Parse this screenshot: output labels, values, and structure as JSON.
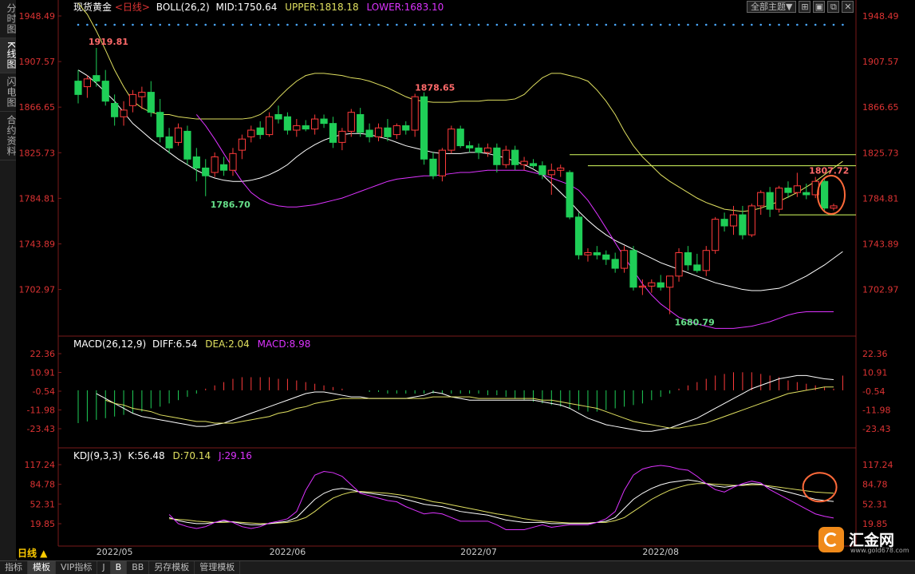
{
  "sidebar": {
    "tabs": [
      "分时图",
      "K线图",
      "闪电图",
      "合约资料"
    ],
    "active": 1
  },
  "header": {
    "symbol": "现货黄金",
    "period": "<日线>",
    "boll_label": "BOLL(26,2)",
    "mid": "MID:1750.64",
    "upper": "UPPER:1818.18",
    "lower": "LOWER:1683.10"
  },
  "top_buttons": {
    "theme": "全部主题▼"
  },
  "macd_header": {
    "name": "MACD(26,12,9)",
    "diff": "DIFF:6.54",
    "dea": "DEA:2.04",
    "macd": "MACD:8.98"
  },
  "kdj_header": {
    "name": "KDJ(9,3,3)",
    "k": "K:56.48",
    "d": "D:70.14",
    "j": "J:29.16"
  },
  "bottom_tabs": [
    "指标",
    "模板",
    "VIP指标",
    "J",
    "B",
    "BB",
    "另存模板",
    "管理模板"
  ],
  "bottom_active": 1,
  "period_label": "日线 ▲",
  "logo": {
    "text": "汇金网",
    "url": "www.gold678.com"
  },
  "colors": {
    "up": "#ff3b3b",
    "down": "#1fce57",
    "mid": "#ffffff",
    "upper": "#e0e060",
    "lower": "#dd33ff",
    "axis": "#d33",
    "diff": "#ffffff",
    "dea": "#e0e060",
    "kdj_k": "#ffffff",
    "kdj_d": "#e0e060",
    "kdj_j": "#dd33ff",
    "highlight": "#ff6a3a"
  },
  "chart_data": [
    {
      "type": "candlestick",
      "title": "现货黄金 <日线>",
      "y_ticks": [
        "1948.49",
        "1907.57",
        "1866.65",
        "1825.73",
        "1784.81",
        "1743.89",
        "1702.97"
      ],
      "ylim": [
        1665,
        1950
      ],
      "x_ticks": [
        "2022/05",
        "2022/06",
        "2022/07",
        "2022/08"
      ],
      "annotations": [
        "1919.81",
        "1786.70",
        "1878.65",
        "1680.79",
        "1807.72"
      ],
      "candles": [
        [
          1890,
          1900,
          1870,
          1878
        ],
        [
          1885,
          1895,
          1875,
          1892
        ],
        [
          1895,
          1919.81,
          1885,
          1890
        ],
        [
          1890,
          1900,
          1868,
          1872
        ],
        [
          1870,
          1878,
          1850,
          1858
        ],
        [
          1858,
          1872,
          1850,
          1864
        ],
        [
          1868,
          1882,
          1862,
          1878
        ],
        [
          1876,
          1885,
          1865,
          1880
        ],
        [
          1880,
          1890,
          1858,
          1862
        ],
        [
          1862,
          1874,
          1835,
          1840
        ],
        [
          1840,
          1848,
          1825,
          1830
        ],
        [
          1835,
          1852,
          1832,
          1848
        ],
        [
          1845,
          1850,
          1815,
          1820
        ],
        [
          1822,
          1830,
          1800,
          1812
        ],
        [
          1812,
          1820,
          1786.7,
          1805
        ],
        [
          1808,
          1826,
          1804,
          1822
        ],
        [
          1815,
          1822,
          1805,
          1810
        ],
        [
          1810,
          1830,
          1805,
          1825
        ],
        [
          1828,
          1842,
          1820,
          1838
        ],
        [
          1840,
          1850,
          1835,
          1846
        ],
        [
          1848,
          1854,
          1838,
          1842
        ],
        [
          1842,
          1862,
          1840,
          1858
        ],
        [
          1860,
          1868,
          1852,
          1856
        ],
        [
          1858,
          1862,
          1842,
          1846
        ],
        [
          1846,
          1856,
          1840,
          1850
        ],
        [
          1850,
          1855,
          1845,
          1847
        ],
        [
          1847,
          1860,
          1842,
          1856
        ],
        [
          1856,
          1860,
          1848,
          1852
        ],
        [
          1852,
          1858,
          1830,
          1835
        ],
        [
          1835,
          1848,
          1828,
          1845
        ],
        [
          1845,
          1865,
          1840,
          1862
        ],
        [
          1860,
          1866,
          1840,
          1844
        ],
        [
          1846,
          1852,
          1835,
          1840
        ],
        [
          1840,
          1852,
          1836,
          1848
        ],
        [
          1848,
          1856,
          1836,
          1840
        ],
        [
          1842,
          1852,
          1838,
          1850
        ],
        [
          1850,
          1854,
          1842,
          1846
        ],
        [
          1846,
          1878.65,
          1840,
          1876
        ],
        [
          1876,
          1880,
          1815,
          1820
        ],
        [
          1820,
          1826,
          1802,
          1805
        ],
        [
          1805,
          1830,
          1800,
          1828
        ],
        [
          1828,
          1850,
          1825,
          1847
        ],
        [
          1847,
          1850,
          1830,
          1832
        ],
        [
          1832,
          1836,
          1826,
          1830
        ],
        [
          1830,
          1834,
          1820,
          1826
        ],
        [
          1826,
          1834,
          1822,
          1830
        ],
        [
          1830,
          1834,
          1808,
          1815
        ],
        [
          1815,
          1832,
          1812,
          1828
        ],
        [
          1828,
          1832,
          1810,
          1815
        ],
        [
          1815,
          1822,
          1810,
          1818
        ],
        [
          1816,
          1820,
          1812,
          1814
        ],
        [
          1814,
          1818,
          1802,
          1806
        ],
        [
          1806,
          1816,
          1788,
          1810
        ],
        [
          1810,
          1815,
          1804,
          1812
        ],
        [
          1808,
          1810,
          1766,
          1768
        ],
        [
          1768,
          1772,
          1730,
          1734
        ],
        [
          1734,
          1740,
          1728,
          1736
        ],
        [
          1736,
          1742,
          1730,
          1734
        ],
        [
          1734,
          1738,
          1725,
          1730
        ],
        [
          1730,
          1736,
          1718,
          1722
        ],
        [
          1722,
          1742,
          1718,
          1738
        ],
        [
          1738,
          1742,
          1702,
          1705
        ],
        [
          1705,
          1712,
          1698,
          1706
        ],
        [
          1706,
          1712,
          1700,
          1709
        ],
        [
          1709,
          1716,
          1702,
          1705
        ],
        [
          1705,
          1712,
          1680.79,
          1715
        ],
        [
          1715,
          1740,
          1710,
          1736
        ],
        [
          1736,
          1742,
          1720,
          1725
        ],
        [
          1725,
          1735,
          1718,
          1720
        ],
        [
          1720,
          1742,
          1715,
          1738
        ],
        [
          1738,
          1768,
          1735,
          1766
        ],
        [
          1766,
          1772,
          1755,
          1760
        ],
        [
          1760,
          1778,
          1752,
          1770
        ],
        [
          1770,
          1778,
          1748,
          1752
        ],
        [
          1752,
          1780,
          1750,
          1778
        ],
        [
          1778,
          1792,
          1770,
          1790
        ],
        [
          1790,
          1795,
          1768,
          1775
        ],
        [
          1775,
          1796,
          1772,
          1794
        ],
        [
          1794,
          1800,
          1785,
          1790
        ],
        [
          1790,
          1807.72,
          1786,
          1796
        ],
        [
          1790,
          1798,
          1784,
          1788
        ],
        [
          1788,
          1804,
          1785,
          1800
        ],
        [
          1800,
          1803,
          1772,
          1776
        ],
        [
          1776,
          1780,
          1774,
          1778
        ]
      ],
      "boll_mid": [
        1900,
        1895,
        1888,
        1880,
        1872,
        1862,
        1852,
        1845,
        1838,
        1832,
        1826,
        1820,
        1815,
        1810,
        1806,
        1803,
        1801,
        1800,
        1800,
        1801,
        1803,
        1806,
        1810,
        1815,
        1822,
        1828,
        1833,
        1837,
        1840,
        1842,
        1843,
        1843,
        1842,
        1840,
        1838,
        1835,
        1832,
        1830,
        1828,
        1826,
        1825,
        1825,
        1825,
        1826,
        1826,
        1825,
        1823,
        1821,
        1818,
        1815,
        1811,
        1806,
        1798,
        1790,
        1782,
        1773,
        1765,
        1758,
        1752,
        1747,
        1743,
        1739,
        1735,
        1731,
        1727,
        1724,
        1721,
        1718,
        1715,
        1712,
        1709,
        1707,
        1705,
        1703,
        1702,
        1702,
        1703,
        1704,
        1707,
        1711,
        1715,
        1720,
        1725,
        1731,
        1737
      ],
      "boll_upper": [
        1960,
        1950,
        1935,
        1918,
        1900,
        1885,
        1872,
        1866,
        1862,
        1860,
        1860,
        1858,
        1857,
        1856,
        1856,
        1856,
        1856,
        1856,
        1856,
        1857,
        1860,
        1866,
        1875,
        1883,
        1890,
        1895,
        1897,
        1897,
        1896,
        1895,
        1893,
        1892,
        1890,
        1887,
        1884,
        1880,
        1876,
        1873,
        1872,
        1871,
        1871,
        1871,
        1872,
        1872,
        1872,
        1873,
        1873,
        1873,
        1874,
        1878,
        1886,
        1893,
        1897,
        1897,
        1895,
        1893,
        1890,
        1882,
        1872,
        1860,
        1845,
        1832,
        1822,
        1814,
        1806,
        1800,
        1795,
        1790,
        1785,
        1781,
        1778,
        1775,
        1774,
        1773,
        1774,
        1776,
        1779,
        1782,
        1786,
        1790,
        1795,
        1800,
        1806,
        1812,
        1818
      ],
      "boll_lower": [
        1860,
        1850,
        1838,
        1825,
        1812,
        1800,
        1790,
        1784,
        1780,
        1778,
        1777,
        1777,
        1778,
        1779,
        1781,
        1783,
        1785,
        1788,
        1791,
        1794,
        1797,
        1800,
        1802,
        1803,
        1804,
        1805,
        1805,
        1806,
        1807,
        1808,
        1808,
        1809,
        1810,
        1810,
        1810,
        1810,
        1810,
        1808,
        1806,
        1803,
        1800,
        1797,
        1792,
        1783,
        1771,
        1758,
        1745,
        1732,
        1720,
        1708,
        1698,
        1690,
        1684,
        1678,
        1675,
        1672,
        1670,
        1668,
        1668,
        1668,
        1669,
        1670,
        1672,
        1674,
        1677,
        1680,
        1682,
        1683,
        1683,
        1683,
        1683
      ],
      "levels": [
        1824,
        1814,
        1770
      ]
    },
    {
      "type": "bar",
      "title": "MACD(26,12,9)",
      "y_ticks": [
        "22.36",
        "10.91",
        "-0.54",
        "-11.98",
        "-23.43"
      ],
      "ylim": [
        -27,
        26
      ],
      "macd": [
        -20,
        -19,
        -18,
        -17,
        -16,
        -15,
        -14,
        -13,
        -11,
        -10,
        -8,
        -6,
        -4,
        -2,
        1,
        3,
        5,
        7,
        8,
        8,
        8,
        8,
        7,
        7,
        6,
        5,
        4,
        3,
        2,
        1,
        0,
        0,
        -1,
        -1,
        -2,
        -2,
        -2,
        -2,
        -2,
        -2,
        -2,
        -2,
        -2,
        -2,
        -2,
        -3,
        -3,
        -4,
        -5,
        -6,
        -7,
        -8,
        -9,
        -10,
        -11,
        -12,
        -13,
        -13,
        -12,
        -11,
        -10,
        -9,
        -8,
        -6,
        -4,
        -2,
        1,
        3,
        5,
        7,
        9,
        10,
        11,
        11,
        11,
        10,
        9,
        8,
        6,
        5,
        4,
        3,
        2,
        1,
        8.98
      ],
      "diff": [
        -2,
        -5,
        -8,
        -11,
        -14,
        -16,
        -17,
        -18,
        -19,
        -20,
        -21,
        -22,
        -22,
        -21,
        -20,
        -18,
        -16,
        -14,
        -12,
        -10,
        -8,
        -6,
        -4,
        -2,
        -1,
        -1,
        -2,
        -3,
        -4,
        -4,
        -5,
        -5,
        -5,
        -5,
        -5,
        -4,
        -3,
        -1,
        -2,
        -4,
        -5,
        -6,
        -6,
        -6,
        -6,
        -6,
        -6,
        -6,
        -6,
        -7,
        -8,
        -9,
        -11,
        -14,
        -17,
        -19,
        -21,
        -22,
        -23,
        -24,
        -25,
        -25,
        -24,
        -23,
        -21,
        -19,
        -17,
        -14,
        -11,
        -8,
        -5,
        -2,
        1,
        3,
        5,
        7,
        8,
        9,
        9,
        8,
        7,
        6.54
      ],
      "dea": [
        -6,
        -8,
        -9,
        -11,
        -12,
        -13,
        -15,
        -16,
        -17,
        -18,
        -19,
        -19,
        -20,
        -20,
        -20,
        -19,
        -18,
        -17,
        -16,
        -14,
        -13,
        -11,
        -10,
        -8,
        -7,
        -6,
        -5,
        -5,
        -5,
        -5,
        -5,
        -5,
        -5,
        -5,
        -5,
        -5,
        -4,
        -4,
        -4,
        -4,
        -4,
        -5,
        -5,
        -5,
        -5,
        -5,
        -5,
        -5,
        -6,
        -6,
        -7,
        -8,
        -9,
        -10,
        -11,
        -13,
        -15,
        -17,
        -19,
        -20,
        -21,
        -22,
        -23,
        -23,
        -22,
        -21,
        -20,
        -18,
        -16,
        -14,
        -12,
        -10,
        -8,
        -6,
        -4,
        -2,
        -1,
        0,
        1,
        2,
        2.04
      ]
    },
    {
      "type": "line",
      "title": "KDJ(9,3,3)",
      "y_ticks": [
        "117.24",
        "84.78",
        "52.31",
        "19.85"
      ],
      "ylim": [
        5,
        125
      ],
      "k": [
        30,
        25,
        22,
        20,
        20,
        22,
        24,
        23,
        20,
        18,
        18,
        20,
        22,
        24,
        30,
        45,
        60,
        70,
        76,
        78,
        76,
        72,
        70,
        68,
        66,
        64,
        60,
        56,
        52,
        50,
        48,
        44,
        40,
        38,
        36,
        34,
        30,
        26,
        24,
        22,
        22,
        22,
        20,
        20,
        20,
        20,
        20,
        22,
        24,
        30,
        45,
        60,
        70,
        78,
        84,
        88,
        90,
        92,
        90,
        86,
        82,
        80,
        82,
        84,
        86,
        85,
        80,
        76,
        72,
        68,
        64,
        60,
        58,
        56.48
      ],
      "d": [
        28,
        27,
        26,
        24,
        23,
        22,
        22,
        23,
        22,
        21,
        20,
        20,
        21,
        22,
        25,
        30,
        40,
        52,
        62,
        68,
        72,
        73,
        72,
        71,
        70,
        68,
        66,
        63,
        60,
        56,
        54,
        51,
        48,
        45,
        42,
        39,
        36,
        34,
        31,
        28,
        26,
        24,
        23,
        22,
        21,
        21,
        21,
        22,
        22,
        25,
        30,
        40,
        50,
        60,
        68,
        75,
        80,
        84,
        86,
        86,
        85,
        84,
        83,
        83,
        84,
        84,
        82,
        80,
        78,
        76,
        74,
        72,
        71,
        70.14
      ],
      "j": [
        35,
        20,
        15,
        12,
        15,
        22,
        26,
        22,
        15,
        12,
        15,
        21,
        24,
        28,
        40,
        75,
        100,
        106,
        104,
        98,
        84,
        70,
        66,
        62,
        58,
        56,
        48,
        42,
        36,
        38,
        36,
        30,
        24,
        24,
        24,
        24,
        18,
        10,
        10,
        10,
        14,
        18,
        14,
        16,
        18,
        18,
        18,
        22,
        28,
        40,
        75,
        100,
        110,
        114,
        116,
        114,
        110,
        108,
        98,
        86,
        76,
        72,
        80,
        86,
        90,
        87,
        76,
        68,
        60,
        52,
        44,
        36,
        32,
        29.16
      ]
    }
  ]
}
